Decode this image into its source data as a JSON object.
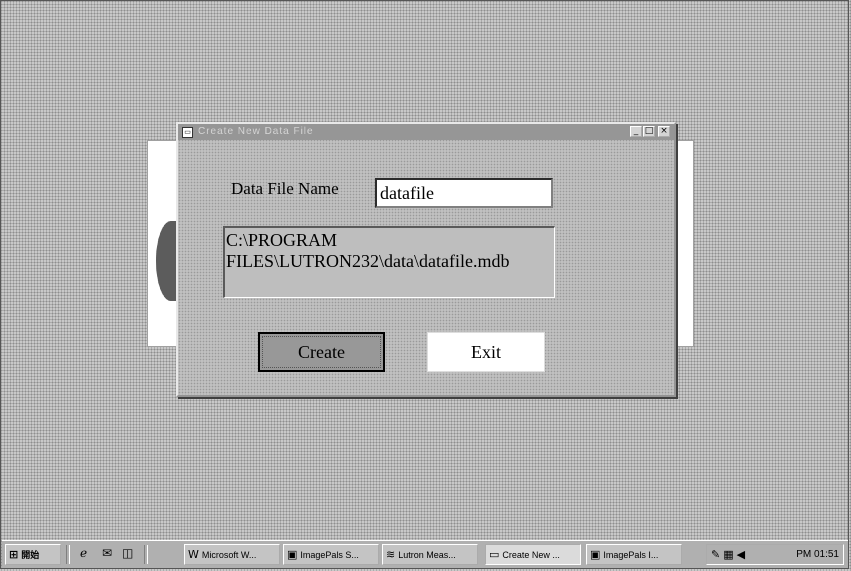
{
  "dialog": {
    "title": "Create New Data File",
    "datafile_label": "Data File Name",
    "datafile_value": "datafile",
    "path_text": "C:\\PROGRAM\nFILES\\LUTRON232\\data\\datafile.mdb",
    "create_label": "Create",
    "exit_label": "Exit",
    "min_glyph": "_",
    "max_glyph": "□",
    "close_glyph": "×"
  },
  "taskbar": {
    "start_label": "開始",
    "items": [
      {
        "label": "Microsoft W...",
        "icon": "word-icon"
      },
      {
        "label": "ImagePals S...",
        "icon": "imagepals-icon"
      },
      {
        "label": "Lutron Meas...",
        "icon": "lutron-icon"
      },
      {
        "label": "Create New ...",
        "icon": "form-icon"
      },
      {
        "label": "ImagePals I...",
        "icon": "imagepals-icon"
      }
    ],
    "clock": "PM 01:51"
  }
}
